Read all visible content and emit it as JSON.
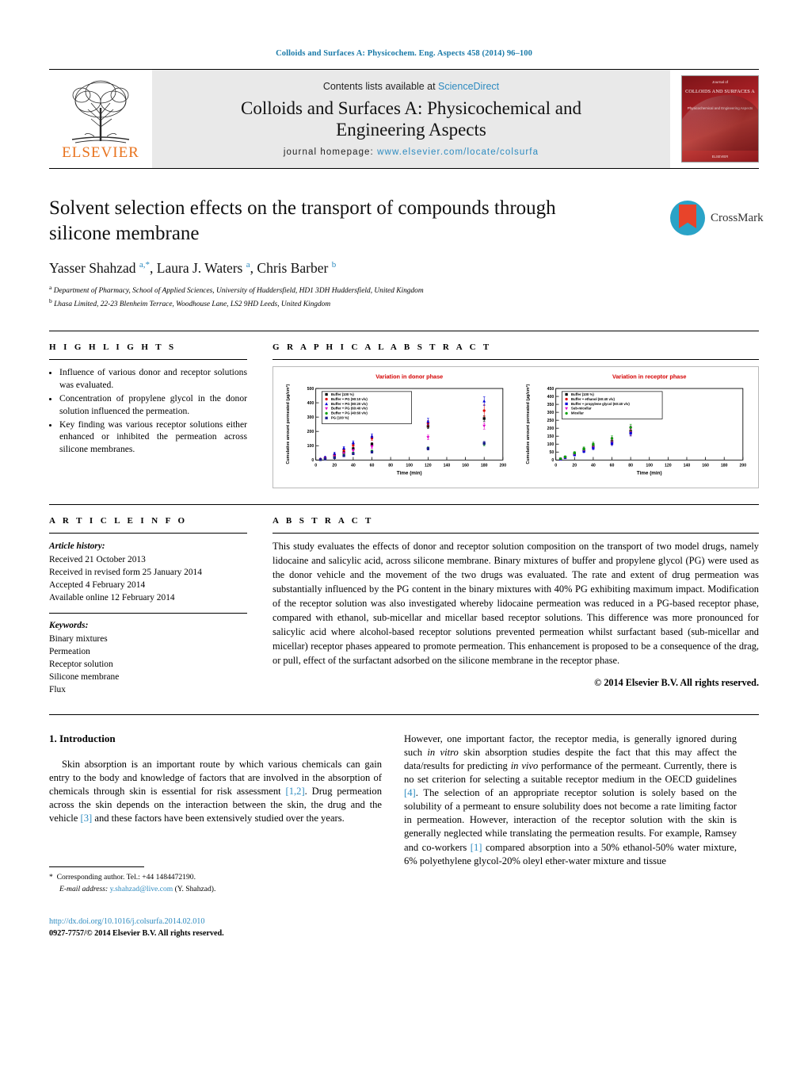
{
  "running_head": "Colloids and Surfaces A: Physicochem. Eng. Aspects 458 (2014) 96–100",
  "masthead": {
    "contents_prefix": "Contents lists available at ",
    "contents_link": "ScienceDirect",
    "journal_title_line1": "Colloids and Surfaces A: Physicochemical and",
    "journal_title_line2": "Engineering Aspects",
    "homepage_prefix": "journal homepage: ",
    "homepage_url": "www.elsevier.com/locate/colsurfa",
    "publisher_wordmark": "ELSEVIER",
    "cover": {
      "top_label": "Journal of",
      "title": "COLLOIDS AND SURFACES A",
      "subtitle": "Physicochemical and Engineering Aspects",
      "footer": "ELSEVIER"
    }
  },
  "article": {
    "title": "Solvent selection effects on the transport of compounds through silicone membrane",
    "crossmark_label": "CrossMark",
    "authors_html": "Yasser Shahzad <sup>a,*</sup>, Laura J. Waters <sup>a</sup>, Chris Barber <sup>b</sup>",
    "affiliation_a": "Department of Pharmacy, School of Applied Sciences, University of Huddersfield, HD1 3DH Huddersfield, United Kingdom",
    "affiliation_b": "Lhasa Limited, 22-23 Blenheim Terrace, Woodhouse Lane, LS2 9HD Leeds, United Kingdom"
  },
  "highlights": {
    "heading": "H I G H L I G H T S",
    "items": [
      "Influence of various donor and receptor solutions was evaluated.",
      "Concentration of propylene glycol in the donor solution influenced the permeation.",
      "Key finding was various receptor solutions either enhanced or inhibited the permeation across silicone membranes."
    ]
  },
  "graphical_abstract": {
    "heading": "G R A P H I C A L   A B S T R A C T"
  },
  "article_info": {
    "heading": "A R T I C L E   I N F O",
    "history_label": "Article history:",
    "history": [
      "Received 21 October 2013",
      "Received in revised form 25 January 2014",
      "Accepted 4 February 2014",
      "Available online 12 February 2014"
    ],
    "keywords_label": "Keywords:",
    "keywords": [
      "Binary mixtures",
      "Permeation",
      "Receptor solution",
      "Silicone membrane",
      "Flux"
    ]
  },
  "abstract": {
    "heading": "A B S T R A C T",
    "text": "This study evaluates the effects of donor and receptor solution composition on the transport of two model drugs, namely lidocaine and salicylic acid, across silicone membrane. Binary mixtures of buffer and propylene glycol (PG) were used as the donor vehicle and the movement of the two drugs was evaluated. The rate and extent of drug permeation was substantially influenced by the PG content in the binary mixtures with 40% PG exhibiting maximum impact. Modification of the receptor solution was also investigated whereby lidocaine permeation was reduced in a PG-based receptor phase, compared with ethanol, sub-micellar and micellar based receptor solutions. This difference was more pronounced for salicylic acid where alcohol-based receptor solutions prevented permeation whilst surfactant based (sub-micellar and micellar) receptor phases appeared to promote permeation. This enhancement is proposed to be a consequence of the drag, or pull, effect of the surfactant adsorbed on the silicone membrane in the receptor phase.",
    "copyright": "© 2014 Elsevier B.V. All rights reserved."
  },
  "introduction": {
    "heading": "1.  Introduction",
    "left_p1_a": "Skin absorption is an important route by which various chemicals can gain entry to the body and knowledge of factors that are involved in the absorption of chemicals through skin is essential for risk assessment ",
    "left_ref_12": "[1,2]",
    "left_p1_b": ". Drug permeation across the skin depends on the interaction between the skin, the drug and the vehicle ",
    "left_ref_3": "[3]",
    "left_p1_c": " and these factors have been extensively studied over the years.",
    "right_p1_a": "However, one important factor, the receptor media, is generally ignored during such ",
    "right_italic_1": "in vitro",
    "right_p1_b": " skin absorption studies despite the fact that this may affect the data/results for predicting ",
    "right_italic_2": "in vivo",
    "right_p1_c": " performance of the permeant. Currently, there is no set criterion for selecting a suitable receptor medium in the OECD guidelines ",
    "right_ref_4": "[4]",
    "right_p1_d": ". The selection of an appropriate receptor solution is solely based on the solubility of a permeant to ensure solubility does not become a rate limiting factor in permeation. However, interaction of the receptor solution with the skin is generally neglected while translating the permeation results. For example, Ramsey and co-workers ",
    "right_ref_1": "[1]",
    "right_p1_e": " compared absorption into a 50% ethanol-50% water mixture, 6% polyethylene glycol-20% oleyl ether-water mixture and tissue"
  },
  "footer": {
    "corresponding_marker": "*",
    "corresponding_text": "Corresponding author. Tel.: +44 1484472190.",
    "email_label": "E-mail address:",
    "email": "y.shahzad@live.com",
    "email_suffix": " (Y. Shahzad).",
    "doi": "http://dx.doi.org/10.1016/j.colsurfa.2014.02.010",
    "issn_line": "0927-7757/© 2014 Elsevier B.V. All rights reserved."
  },
  "chart_data": [
    {
      "type": "scatter",
      "title": "Variation in donor phase",
      "title_color": "#d40000",
      "xlabel": "Time (min)",
      "ylabel": "Cumulative amount permeated (µg/cm²)",
      "xlim": [
        0,
        200
      ],
      "xticks": [
        0,
        20,
        40,
        60,
        80,
        100,
        120,
        140,
        160,
        180,
        200
      ],
      "ylim": [
        0,
        500
      ],
      "yticks": [
        0,
        100,
        200,
        300,
        400,
        500
      ],
      "legend_position": "top-left",
      "x": [
        5,
        10,
        20,
        30,
        40,
        60,
        120,
        180
      ],
      "series": [
        {
          "name": "Buffer (100 %)",
          "color": "#000000",
          "marker": "square",
          "values": [
            4,
            12,
            28,
            52,
            78,
            110,
            235,
            290
          ],
          "errors": [
            3,
            4,
            6,
            8,
            10,
            12,
            16,
            20
          ]
        },
        {
          "name": "Buffer + PG (90:10 v/v)",
          "color": "#e00000",
          "marker": "circle",
          "values": [
            6,
            16,
            38,
            70,
            104,
            152,
            255,
            345
          ],
          "errors": [
            3,
            5,
            7,
            9,
            11,
            14,
            20,
            40
          ]
        },
        {
          "name": "Buffer + PG (80:20 v/v)",
          "color": "#0000d8",
          "marker": "triangle",
          "values": [
            8,
            20,
            46,
            84,
            122,
            168,
            270,
            412
          ],
          "errors": [
            3,
            5,
            8,
            10,
            12,
            15,
            22,
            30
          ]
        },
        {
          "name": "Buffer + PG (60:40 v/v)",
          "color": "#e000c8",
          "marker": "triangle-down",
          "values": [
            4,
            10,
            24,
            46,
            66,
            92,
            158,
            238
          ],
          "errors": [
            3,
            4,
            6,
            8,
            9,
            11,
            16,
            22
          ]
        },
        {
          "name": "Buffer + PG (40:60 v/v)",
          "color": "#00a000",
          "marker": "circle",
          "values": [
            3,
            8,
            18,
            34,
            48,
            62,
            82,
            112
          ],
          "errors": [
            2,
            3,
            5,
            6,
            7,
            8,
            10,
            12
          ]
        },
        {
          "name": "PG (100 %)",
          "color": "#1a1a8c",
          "marker": "square",
          "values": [
            3,
            7,
            16,
            30,
            44,
            56,
            80,
            118
          ],
          "errors": [
            2,
            3,
            4,
            6,
            7,
            8,
            10,
            12
          ]
        }
      ]
    },
    {
      "type": "scatter",
      "title": "Variation in receptor phase",
      "title_color": "#d40000",
      "xlabel": "Time (min)",
      "ylabel": "Cumulative amount permeated (µg/cm²)",
      "xlim": [
        0,
        200
      ],
      "xticks": [
        0,
        20,
        40,
        60,
        80,
        100,
        120,
        140,
        160,
        180,
        200
      ],
      "ylim": [
        0,
        450
      ],
      "yticks": [
        0,
        50,
        100,
        150,
        200,
        250,
        300,
        350,
        400,
        450
      ],
      "legend_position": "top-left",
      "x": [
        5,
        10,
        20,
        30,
        40,
        60,
        80
      ],
      "series": [
        {
          "name": "Buffer (100 %)",
          "color": "#000000",
          "marker": "square",
          "values": [
            6,
            16,
            38,
            62,
            86,
            118,
            182
          ],
          "errors": [
            4,
            5,
            7,
            9,
            11,
            14,
            18
          ]
        },
        {
          "name": "Buffer + ethanol (60:40 v/v)",
          "color": "#e00000",
          "marker": "circle",
          "values": [
            6,
            15,
            35,
            58,
            80,
            110,
            172
          ],
          "errors": [
            4,
            5,
            7,
            9,
            11,
            14,
            18
          ]
        },
        {
          "name": "Buffer + propylene glycol (60:40 v/v)",
          "color": "#0000d8",
          "marker": "square",
          "values": [
            5,
            14,
            33,
            55,
            76,
            104,
            168
          ],
          "errors": [
            4,
            5,
            7,
            9,
            11,
            13,
            17
          ]
        },
        {
          "name": "Sub-micellar",
          "color": "#e000c8",
          "marker": "triangle-down",
          "values": [
            7,
            18,
            42,
            68,
            94,
            128,
            196
          ],
          "errors": [
            4,
            6,
            8,
            10,
            12,
            15,
            19
          ]
        },
        {
          "name": "Micellar",
          "color": "#00a000",
          "marker": "circle",
          "values": [
            8,
            20,
            45,
            72,
            100,
            136,
            205
          ],
          "errors": [
            4,
            6,
            8,
            10,
            12,
            16,
            20
          ]
        }
      ]
    }
  ]
}
